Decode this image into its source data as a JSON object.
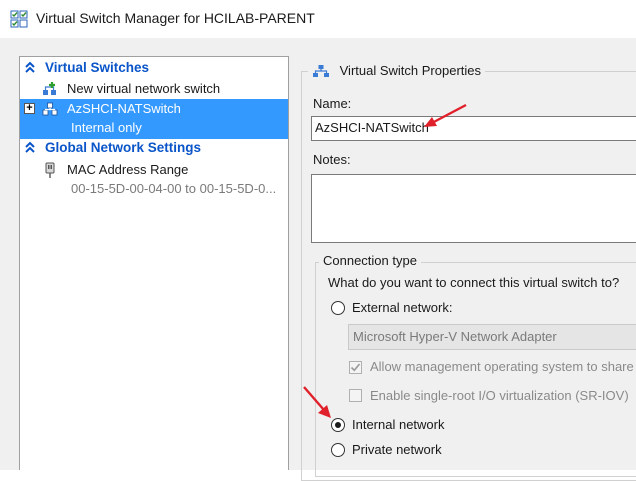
{
  "window": {
    "title": "Virtual Switch Manager for HCILAB-PARENT"
  },
  "left_pane": {
    "virtual_switches": {
      "header": "Virtual Switches",
      "new_switch": "New virtual network switch",
      "switch": {
        "name": "AzSHCI-NATSwitch",
        "type": "Internal only",
        "expand_glyph": "+"
      }
    },
    "global_settings": {
      "header": "Global Network Settings",
      "mac_range": {
        "label": "MAC Address Range",
        "value": "00-15-5D-00-04-00 to 00-15-5D-0..."
      }
    }
  },
  "properties": {
    "group_title": "Virtual Switch Properties",
    "name_label": "Name:",
    "name_value": "AzSHCI-NATSwitch",
    "notes_label": "Notes:",
    "notes_value": "",
    "connection": {
      "group_title": "Connection type",
      "question": "What do you want to connect this virtual switch to?",
      "external_label": "External network:",
      "adapter_value": "Microsoft Hyper-V Network Adapter",
      "allow_mgmt_label": "Allow management operating system to share t",
      "sriov_label": "Enable single-root I/O virtualization (SR-IOV)",
      "internal_label": "Internal network",
      "private_label": "Private network",
      "selected": "internal"
    }
  },
  "colors": {
    "selection": "#3399ff",
    "section_header": "#0a55c9",
    "annotation_arrow": "#e0202a"
  },
  "icons": [
    "virtual-switch-manager-icon",
    "double-chevron-up-icon",
    "add-network-switch-icon",
    "network-switch-icon",
    "network-plug-icon",
    "expand-icon",
    "red-arrow-icon"
  ]
}
